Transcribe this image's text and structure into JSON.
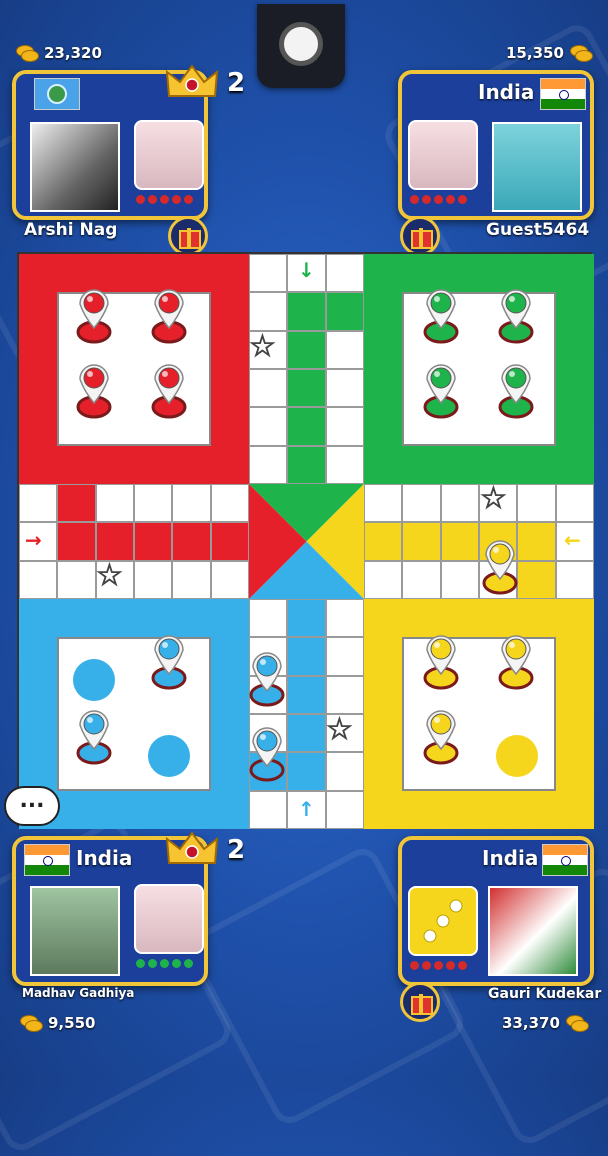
{
  "players": {
    "top_left": {
      "name": "Arshi Nag",
      "coins": "23,320",
      "country": "",
      "flag": "globe-icon",
      "crown_count": "2"
    },
    "top_right": {
      "name": "Guest5464",
      "coins": "15,350",
      "country": "India",
      "flag": "india-flag"
    },
    "bottom_left": {
      "name": "Madhav Gadhiya",
      "coins": "9,550",
      "country": "India",
      "flag": "india-flag",
      "crown_count": "2"
    },
    "bottom_right": {
      "name": "Gauri Kudekar",
      "coins": "33,370",
      "country": "India",
      "flag": "india-flag",
      "dice_value": 3
    }
  },
  "chat": {
    "label": "..."
  },
  "colors": {
    "red": "#e5202a",
    "green": "#1fb34b",
    "blue": "#37b0ea",
    "yellow": "#f6d51d",
    "panel": "#1b3f9a",
    "gold": "#f1c53a"
  },
  "tokens": {
    "red": "4 in home",
    "green": "4 in home",
    "blue": "2 in home, 2 on track",
    "yellow": "3 in home, 1 on track"
  }
}
